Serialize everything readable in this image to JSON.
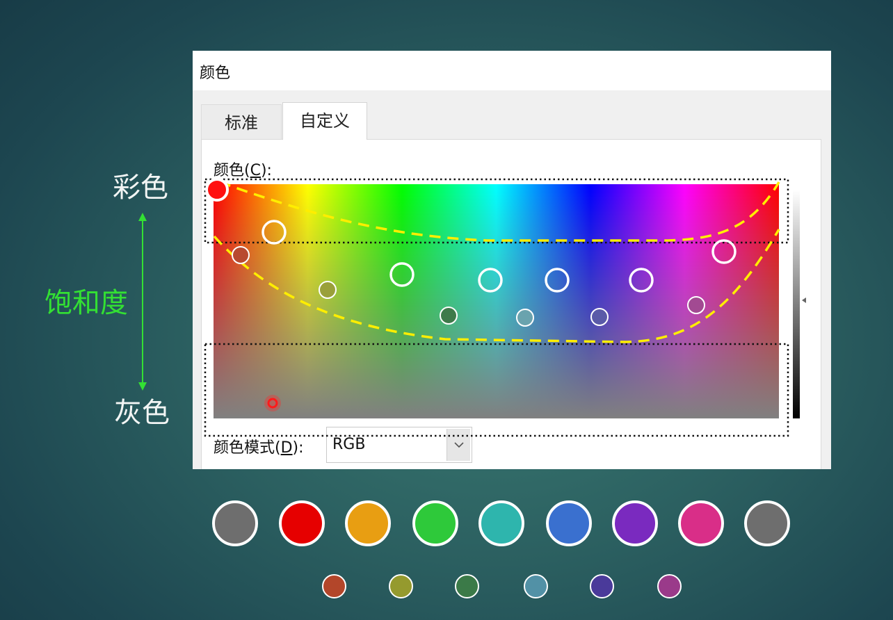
{
  "side_labels": {
    "colorful": "彩色",
    "saturation": "饱和度",
    "gray": "灰色"
  },
  "dialog": {
    "title": "颜色",
    "tabs": [
      {
        "label": "标准",
        "selected": false
      },
      {
        "label": "自定义",
        "selected": true
      }
    ],
    "colors_label_prefix": "颜色(",
    "colors_label_key": "C",
    "colors_label_suffix": "):",
    "mode_label_prefix": "颜色模式(",
    "mode_label_key": "D",
    "mode_label_suffix": "):",
    "mode_value": "RGB"
  },
  "swatches_large": [
    {
      "name": "gray",
      "color": "#6e6e6e"
    },
    {
      "name": "red",
      "color": "#e60000"
    },
    {
      "name": "orange",
      "color": "#e89e12"
    },
    {
      "name": "green",
      "color": "#2ec93a"
    },
    {
      "name": "teal",
      "color": "#2eb5ad"
    },
    {
      "name": "blue",
      "color": "#3a70cf"
    },
    {
      "name": "purple",
      "color": "#7a2abf"
    },
    {
      "name": "pink",
      "color": "#d92e88"
    },
    {
      "name": "gray-2",
      "color": "#6e6e6e"
    }
  ],
  "swatches_small": [
    {
      "name": "rust",
      "color": "#b3462a"
    },
    {
      "name": "olive",
      "color": "#959a2e"
    },
    {
      "name": "dark-green",
      "color": "#3b7a48"
    },
    {
      "name": "steel-blue",
      "color": "#5291a6"
    },
    {
      "name": "indigo",
      "color": "#4a3a9a"
    },
    {
      "name": "plum",
      "color": "#9a3a8a"
    }
  ],
  "colors": {
    "accent_label": "#33e033",
    "dashed_curve": "#ffee00"
  }
}
